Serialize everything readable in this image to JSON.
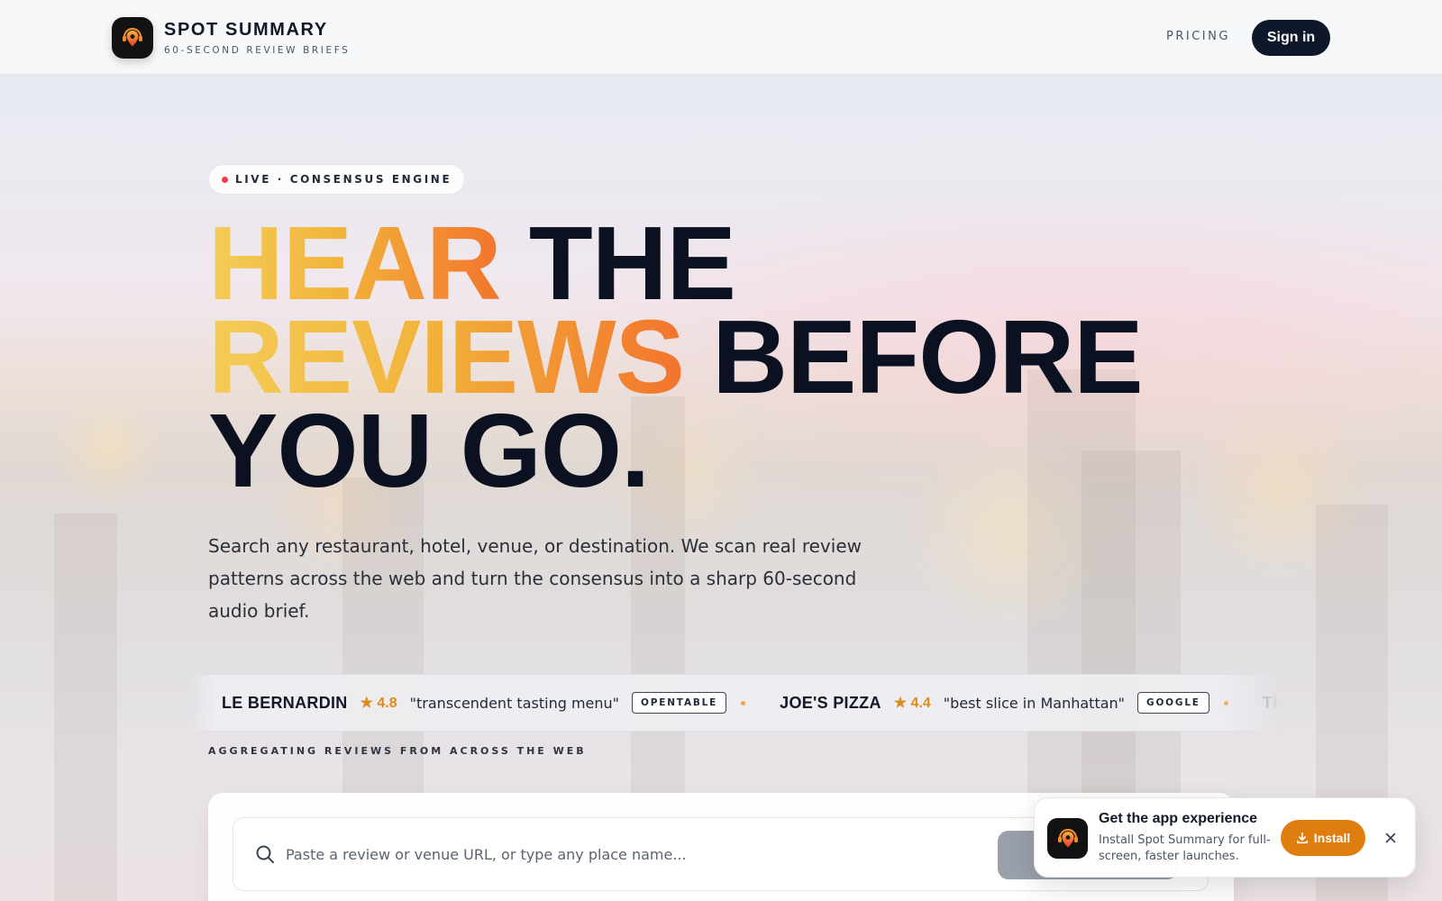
{
  "header": {
    "brand_name": "SPOT SUMMARY",
    "brand_tagline": "60-SECOND REVIEW BRIEFS",
    "nav_pricing": "PRICING",
    "sign_in_label": "Sign in"
  },
  "hero": {
    "live_badge": "LIVE · CONSENSUS ENGINE",
    "headline": {
      "line1_accent": "HEAR",
      "line1_rest": "THE",
      "line2_accent": "REVIEWS",
      "line2_rest": "BEFORE",
      "line3": "YOU GO."
    },
    "subtitle": "Search any restaurant, hotel, venue, or destination. We scan real review patterns across the web and turn the consensus into a sharp 60-second audio brief."
  },
  "ticker": {
    "items": [
      {
        "name": "LE BERNARDIN",
        "rating": "4.8",
        "quote": "\"transcendent tasting menu\"",
        "source": "OPENTABLE"
      },
      {
        "name": "JOE'S PIZZA",
        "rating": "4.4",
        "quote": "\"best slice in Manhattan\"",
        "source": "GOOGLE"
      },
      {
        "name": "THE N",
        "rating": "",
        "quote": "",
        "source": ""
      }
    ],
    "caption": "AGGREGATING REVIEWS FROM ACROSS THE WEB"
  },
  "search": {
    "placeholder": "Paste a review or venue URL, or type any place name...",
    "value": ""
  },
  "install_toast": {
    "title": "Get the app experience",
    "description": "Install Spot Summary for full-screen, faster launches.",
    "install_label": "Install"
  },
  "colors": {
    "brand_dark": "#0f172a",
    "accent_orange": "#e07d0f",
    "gradient_start": "#f4cc58",
    "gradient_end": "#f2742d",
    "live_dot": "#ef3b4d"
  }
}
